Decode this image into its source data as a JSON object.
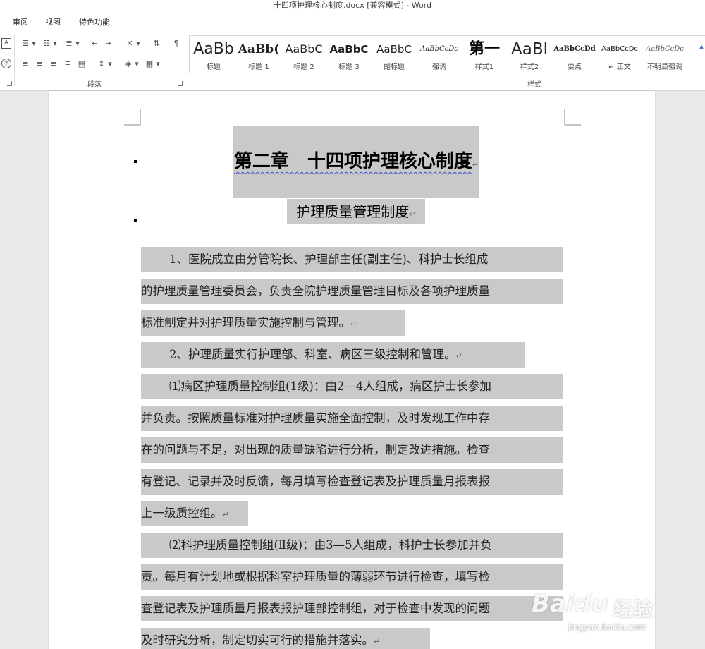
{
  "window": {
    "title": "十四项护理核心制度.docx [兼容模式] - Word"
  },
  "menu": {
    "tabs": [
      "审阅",
      "视图",
      "特色功能"
    ]
  },
  "ribbon": {
    "paragraph_group_label": "段落",
    "styles_group_label": "样式",
    "icons": [
      "char-border-icon",
      "phonetic-guide-icon",
      "bullets-icon",
      "numbering-icon",
      "multilevel-list-icon",
      "decrease-indent-icon",
      "increase-indent-icon",
      "asian-layout-icon",
      "sort-icon",
      "show-marks-icon",
      "align-left-icon",
      "center-icon",
      "align-right-icon",
      "justify-icon",
      "distributed-icon",
      "line-spacing-icon",
      "shading-icon",
      "borders-icon"
    ],
    "styles": [
      {
        "sample": "AaBb",
        "name": "标题"
      },
      {
        "sample": "AaBb(",
        "name": "标题 1"
      },
      {
        "sample": "AaBbC",
        "name": "标题 2"
      },
      {
        "sample": "AaBbC",
        "name": "标题 3"
      },
      {
        "sample": "AaBbC",
        "name": "副标题"
      },
      {
        "sample": "AaBbCcDc",
        "name": "强调"
      },
      {
        "sample": "第一",
        "name": "样式1"
      },
      {
        "sample": "AaBl",
        "name": "样式2"
      },
      {
        "sample": "AaBbCcDd",
        "name": "要点"
      },
      {
        "sample": "AaBbCcDc",
        "name": "↵ 正文"
      },
      {
        "sample": "AaBbCcDc",
        "name": "不明显强调"
      }
    ]
  },
  "document": {
    "heading1": "第二章　十四项护理核心制度",
    "heading2": "护理质量管理制度",
    "para_mark": "↵",
    "lines": [
      "1、医院成立由分管院长、护理部主任(副主任)、科护士长组成",
      "的护理质量管理委员会，负责全院护理质量管理目标及各项护理质量",
      "标准制定并对护理质量实施控制与管理。",
      "2、护理质量实行护理部、科室、病区三级控制和管理。",
      "⑴病区护理质量控制组(1级)：由2—4人组成，病区护士长参加",
      "并负责。按照质量标准对护理质量实施全面控制，及时发现工作中存",
      "在的问题与不足，对出现的质量缺陷进行分析，制定改进措施。检查",
      "有登记、记录并及时反馈，每月填写检查登记表及护理质量月报表报",
      "上一级质控组。",
      "⑵科护理质量控制组(Ⅱ级)：由3—5人组成，科护士长参加并负",
      "责。每月有计划地或根据科室护理质量的薄弱环节进行检查，填写检",
      "查登记表及护理质量月报表报护理部控制组，对于检查中发现的问题",
      "及时研究分析，制定切实可行的措施并落实。"
    ]
  },
  "watermark": {
    "logo": "Baidu",
    "jingyan": "经验",
    "url": "jingyan.baidu.com"
  }
}
